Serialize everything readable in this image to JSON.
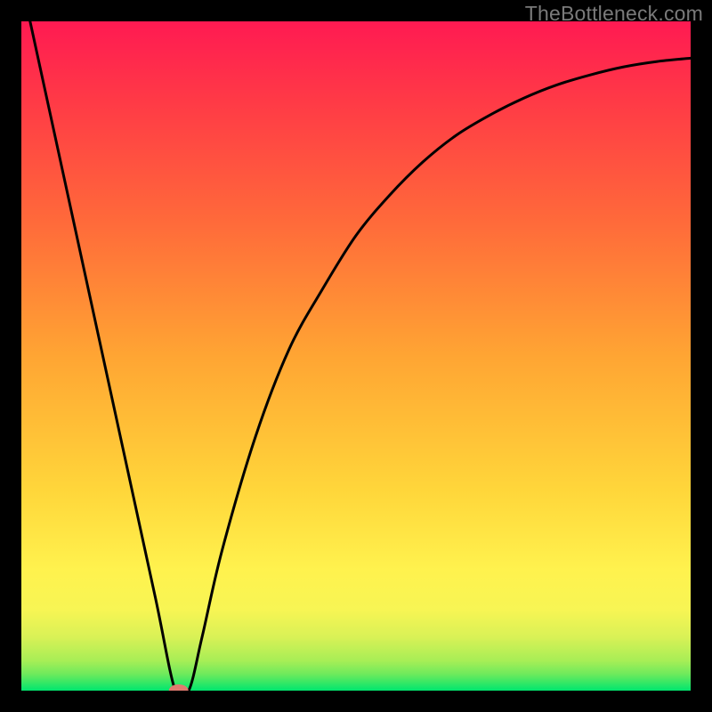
{
  "watermark": "TheBottleneck.com",
  "chart_data": {
    "type": "line",
    "title": "",
    "xlabel": "",
    "ylabel": "",
    "xlim": [
      0,
      100
    ],
    "ylim": [
      0,
      100
    ],
    "grid": false,
    "series": [
      {
        "name": "curve",
        "x": [
          0,
          5,
          10,
          15,
          20,
          23,
          25,
          27,
          30,
          35,
          40,
          45,
          50,
          55,
          60,
          65,
          70,
          75,
          80,
          85,
          90,
          95,
          100
        ],
        "y": [
          106,
          83,
          60,
          37,
          14,
          0,
          0,
          8,
          21,
          38,
          51,
          60,
          68,
          74,
          79,
          83,
          86,
          88.5,
          90.5,
          92,
          93.2,
          94,
          94.5
        ]
      }
    ],
    "marker": {
      "x": 23.5,
      "y": 0,
      "color": "#e07a6f"
    },
    "bands": [
      {
        "from": 0,
        "to": 2,
        "color": "#00e66e"
      },
      {
        "from": 2,
        "to": 5,
        "color": "#7bed5c"
      },
      {
        "from": 5,
        "to": 10,
        "color": "#d3ef56"
      },
      {
        "from": 10,
        "to": 18,
        "color": "#f7f354"
      },
      {
        "from": 18,
        "to": 100,
        "color": "gradient"
      }
    ],
    "gradient_top": "#ff1a52",
    "gradient_bottom": "#fff94f"
  }
}
